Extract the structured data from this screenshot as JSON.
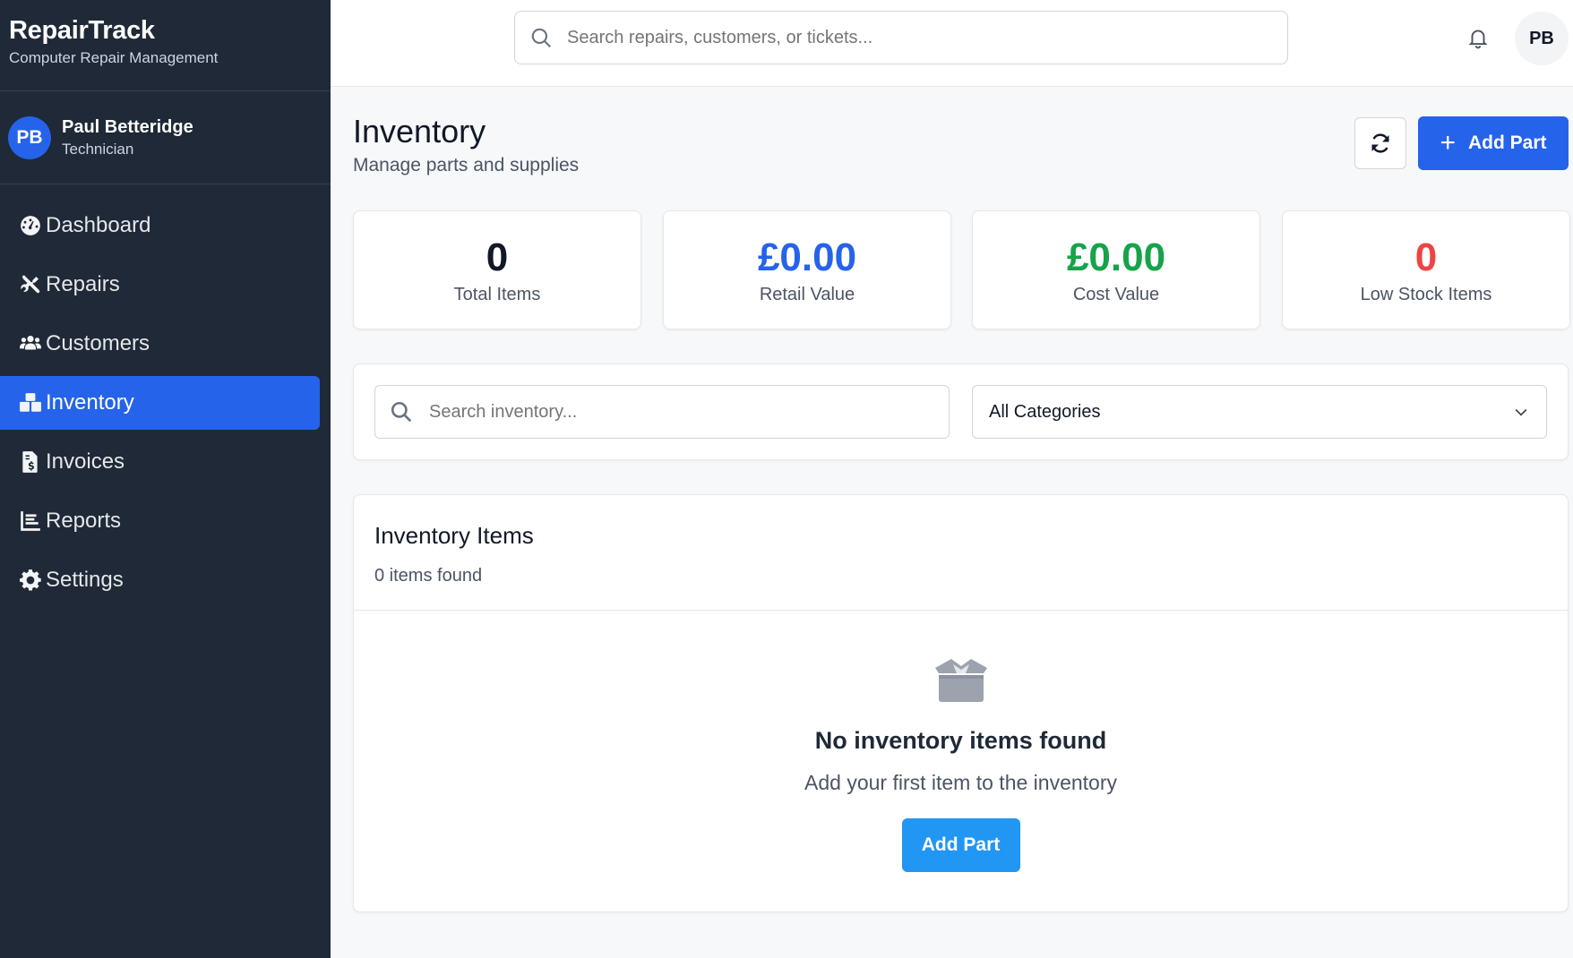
{
  "app": {
    "title": "RepairTrack",
    "subtitle": "Computer Repair Management"
  },
  "user": {
    "initials": "PB",
    "name": "Paul Betteridge",
    "role": "Technician"
  },
  "nav": [
    {
      "label": "Dashboard",
      "icon": "dashboard-icon"
    },
    {
      "label": "Repairs",
      "icon": "tools-icon"
    },
    {
      "label": "Customers",
      "icon": "users-icon"
    },
    {
      "label": "Inventory",
      "icon": "boxes-icon",
      "active": true
    },
    {
      "label": "Invoices",
      "icon": "invoice-icon"
    },
    {
      "label": "Reports",
      "icon": "chart-icon"
    },
    {
      "label": "Settings",
      "icon": "gear-icon"
    }
  ],
  "topbar": {
    "search_placeholder": "Search repairs, customers, or tickets...",
    "avatar_initials": "PB"
  },
  "page": {
    "title": "Inventory",
    "subtitle": "Manage parts and supplies",
    "add_button": "Add Part"
  },
  "stats": [
    {
      "value": "0",
      "label": "Total Items",
      "color": "#111827"
    },
    {
      "value": "£0.00",
      "label": "Retail Value",
      "color": "#2563eb"
    },
    {
      "value": "£0.00",
      "label": "Cost Value",
      "color": "#16a34a"
    },
    {
      "value": "0",
      "label": "Low Stock Items",
      "color": "#ef4444"
    }
  ],
  "filters": {
    "search_placeholder": "Search inventory...",
    "category": "All Categories"
  },
  "items": {
    "title": "Inventory Items",
    "count_text": "0 items found",
    "empty_title": "No inventory items found",
    "empty_subtitle": "Add your first item to the inventory",
    "empty_button": "Add Part"
  },
  "colors": {
    "sidebar": "#1f2937",
    "accent": "#2563eb",
    "empty_button": "#2196f3"
  }
}
